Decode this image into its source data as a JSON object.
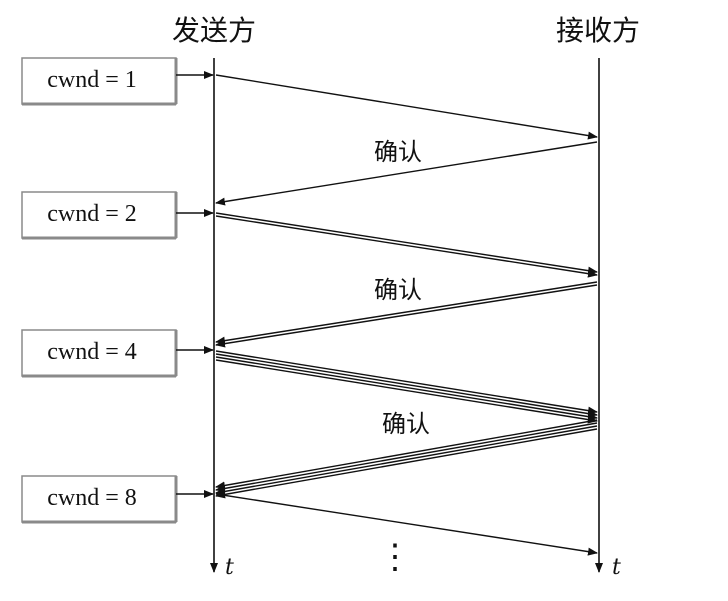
{
  "sender_label": "发送方",
  "receiver_label": "接收方",
  "time_label_sender": "t",
  "time_label_receiver": "t",
  "ack_label": "确认",
  "continuation": "⋮",
  "cwnd_labels": [
    "cwnd = 1",
    "cwnd = 2",
    "cwnd = 4",
    "cwnd = 8"
  ],
  "rounds": [
    {
      "cwnd": 1,
      "segments": 1,
      "ack_text": "确认"
    },
    {
      "cwnd": 2,
      "segments": 2,
      "ack_text": "确认"
    },
    {
      "cwnd": 4,
      "segments": 4,
      "ack_text": "确认"
    },
    {
      "cwnd": 8,
      "segments": 1
    }
  ],
  "colors": {
    "line": "#111111",
    "box_shadow": "#8a8a8a",
    "background": "#ffffff"
  }
}
